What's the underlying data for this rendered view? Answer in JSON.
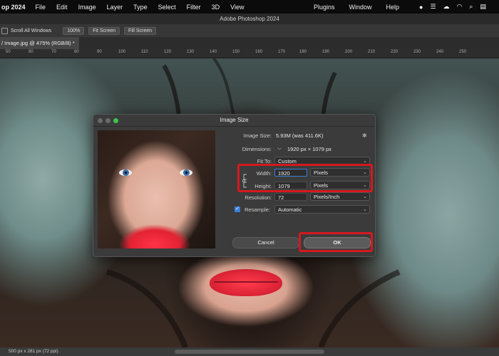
{
  "menubar": {
    "app": "op 2024",
    "items": [
      "File",
      "Edit",
      "Image",
      "Layer",
      "Type",
      "Select",
      "Filter",
      "3D",
      "View"
    ],
    "right_items": [
      "Plugins",
      "Window",
      "Help"
    ]
  },
  "window_title": "Adobe Photoshop 2024",
  "options_bar": {
    "scroll_all_label": "Scroll All Windows",
    "zoom_label": "100%",
    "fit_screen_1": "Fit Screen",
    "fit_screen_2": "Fill Screen"
  },
  "doc_tab": "/ Image.jpg @ 475% (RGB/8) *",
  "ruler_ticks": [
    "50",
    "60",
    "70",
    "80",
    "90",
    "100",
    "110",
    "120",
    "130",
    "140",
    "150",
    "160",
    "170",
    "180",
    "190",
    "200",
    "210",
    "220",
    "230",
    "240",
    "250"
  ],
  "status": "500 px x 281 px (72 ppi)",
  "dialog": {
    "title": "Image Size",
    "image_size_label": "Image Size:",
    "image_size_value": "5.93M (was 411.6K)",
    "dimensions_label": "Dimensions:",
    "dimensions_value": "1920 px  ×  1079 px",
    "fit_to_label": "Fit To:",
    "fit_to_value": "Custom",
    "width_label": "Width:",
    "width_value": "1920",
    "width_unit": "Pixels",
    "height_label": "Height:",
    "height_value": "1079",
    "height_unit": "Pixels",
    "resolution_label": "Resolution:",
    "resolution_value": "72",
    "resolution_unit": "Pixels/Inch",
    "resample_label": "Resample:",
    "resample_value": "Automatic",
    "resample_checked": true,
    "cancel_label": "Cancel",
    "ok_label": "OK"
  },
  "colors": {
    "highlight": "#d3191f",
    "accent": "#3d7fd8"
  }
}
